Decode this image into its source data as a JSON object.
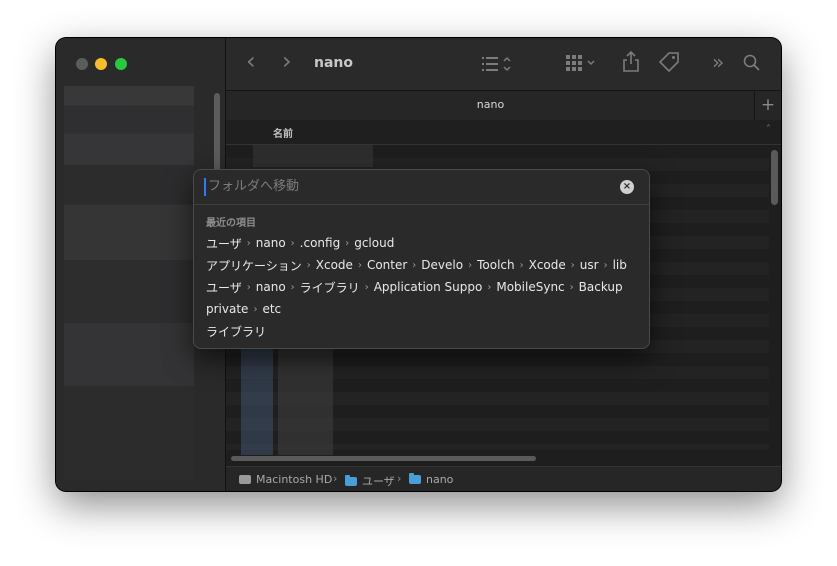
{
  "window": {
    "title": "nano",
    "tab_label": "nano",
    "tab_plus": "+"
  },
  "toolbar": {
    "back_icon": "chevron-left-icon",
    "forward_icon": "chevron-right-icon",
    "back_glyph": "‹",
    "forward_glyph": "›",
    "list_view_icon": "list-view-icon",
    "grid_view_icon": "grid-view-icon",
    "share_icon": "share-icon",
    "tag_icon": "tag-icon",
    "more_glyph": "»",
    "search_icon": "search-icon"
  },
  "list": {
    "column_name": "名前",
    "chevron": "˄"
  },
  "pathbar": {
    "items": [
      "Macintosh HD",
      "ユーザ",
      "nano"
    ],
    "separator": "›"
  },
  "goto": {
    "placeholder": "フォルダへ移動",
    "section": "最近の項目",
    "clear_glyph": "×",
    "recents": [
      [
        "ユーザ",
        "nano",
        ".config",
        "gcloud"
      ],
      [
        "アプリケーション",
        "Xcode",
        "Conter",
        "Develo",
        "Toolch",
        "Xcode",
        "usr",
        "lib"
      ],
      [
        "ユーザ",
        "nano",
        "ライブラリ",
        "Application Suppo",
        "MobileSync",
        "Backup"
      ],
      [
        "private",
        "etc"
      ],
      [
        "ライブラリ"
      ]
    ],
    "separator": "›"
  },
  "colors": {
    "accent": "#2d7cf6",
    "folder": "#4a9ed8",
    "close": "#5d5c5c",
    "minimize": "#f5bd2f",
    "maximize": "#28c840"
  }
}
